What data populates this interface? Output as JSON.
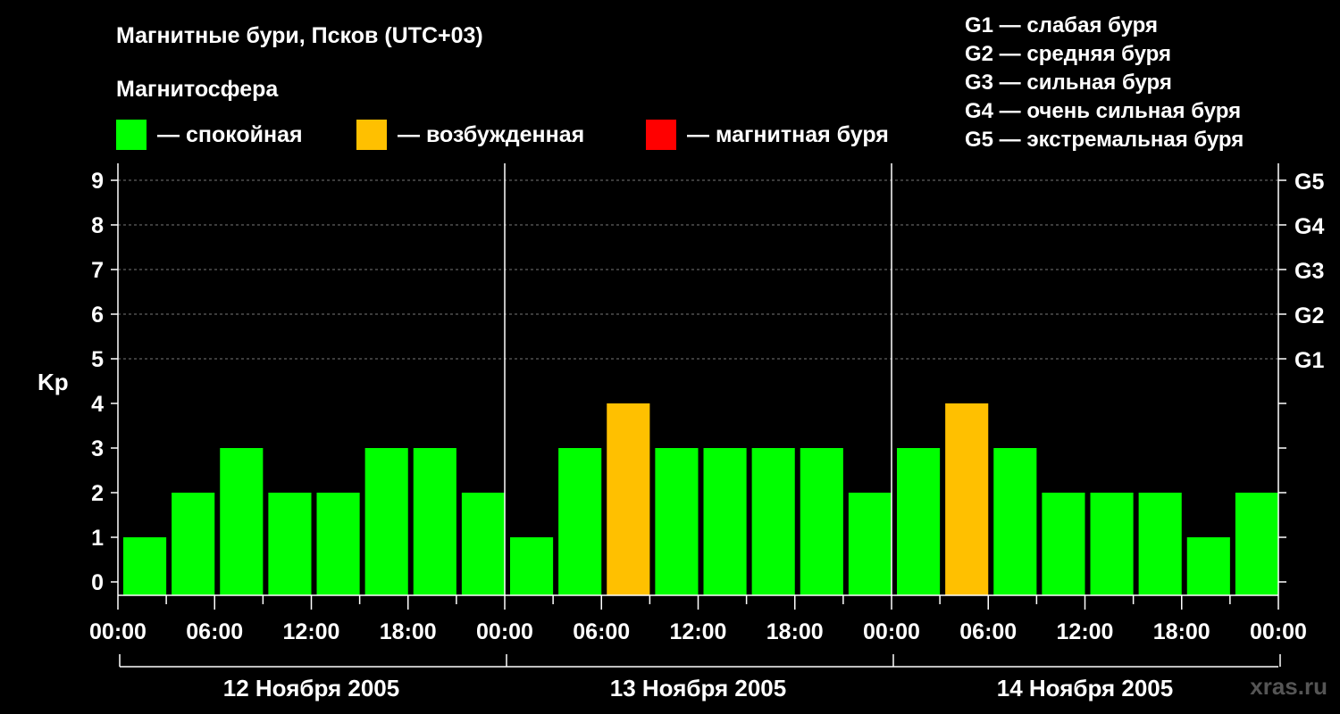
{
  "title": "Магнитные бури, Псков (UTC+03)",
  "subtitle": "Магнитосфера",
  "legend": [
    {
      "label": "— спокойная",
      "color": "#00ff00"
    },
    {
      "label": "— возбужденная",
      "color": "#ffc000"
    },
    {
      "label": "— магнитная буря",
      "color": "#ff0000"
    }
  ],
  "g_legend": [
    "G1 — слабая буря",
    "G2 — средняя буря",
    "G3 — сильная буря",
    "G4 — очень сильная буря",
    "G5 — экстремальная буря"
  ],
  "watermark": "xras.ru",
  "chart_data": {
    "type": "bar",
    "ylabel": "Kp",
    "ylim": [
      0,
      9
    ],
    "y_ticks": [
      "0",
      "1",
      "2",
      "3",
      "4",
      "5",
      "6",
      "7",
      "8",
      "9"
    ],
    "right_ticks": [
      {
        "value": 5,
        "label": "G1"
      },
      {
        "value": 6,
        "label": "G2"
      },
      {
        "value": 7,
        "label": "G3"
      },
      {
        "value": 8,
        "label": "G4"
      },
      {
        "value": 9,
        "label": "G5"
      }
    ],
    "x_tick_labels": [
      "00:00",
      "06:00",
      "12:00",
      "18:00",
      "00:00",
      "06:00",
      "12:00",
      "18:00",
      "00:00",
      "06:00",
      "12:00",
      "18:00",
      "00:00"
    ],
    "days": [
      "12 Ноября 2005",
      "13 Ноября 2005",
      "14 Ноября 2005"
    ],
    "values": [
      1,
      2,
      3,
      2,
      2,
      3,
      3,
      2,
      1,
      3,
      4,
      3,
      3,
      3,
      3,
      2,
      3,
      4,
      3,
      2,
      2,
      2,
      1,
      2
    ],
    "thresholds": {
      "quiet_max": 3,
      "active": 4,
      "storm_min": 5
    },
    "colors": {
      "quiet": "#00ff00",
      "active": "#ffc000",
      "storm": "#ff0000"
    },
    "grid": "dashed",
    "legend_position": "top"
  }
}
